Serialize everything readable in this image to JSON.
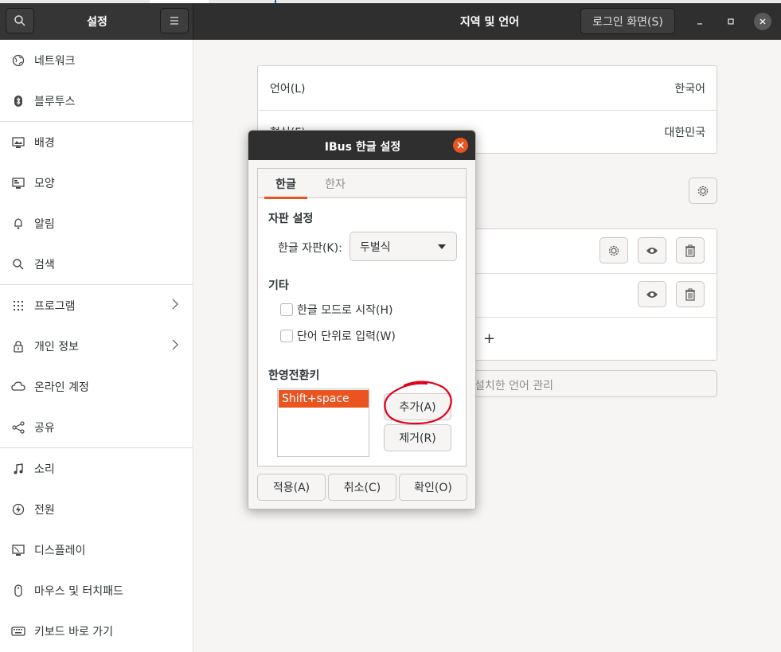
{
  "header": {
    "sidebar_title": "설정",
    "page_title": "지역 및 언어",
    "login_screen_button": "로그인 화면(S)"
  },
  "sidebar": {
    "items": [
      {
        "label": "네트워크",
        "icon": "network-icon"
      },
      {
        "label": "블루투스",
        "icon": "bluetooth-icon"
      },
      {
        "label": "배경",
        "icon": "background-icon"
      },
      {
        "label": "모양",
        "icon": "appearance-icon"
      },
      {
        "label": "알림",
        "icon": "bell-icon"
      },
      {
        "label": "검색",
        "icon": "search-icon"
      },
      {
        "label": "프로그램",
        "icon": "apps-grid-icon"
      },
      {
        "label": "개인 정보",
        "icon": "lock-icon"
      },
      {
        "label": "온라인 계정",
        "icon": "cloud-icon"
      },
      {
        "label": "공유",
        "icon": "share-icon"
      },
      {
        "label": "소리",
        "icon": "music-note-icon"
      },
      {
        "label": "전원",
        "icon": "power-icon"
      },
      {
        "label": "디스플레이",
        "icon": "display-icon"
      },
      {
        "label": "마우스 및 터치패드",
        "icon": "mouse-icon"
      },
      {
        "label": "키보드 바로 가기",
        "icon": "keyboard-icon"
      }
    ]
  },
  "region": {
    "language_label": "언어(L)",
    "language_value": "한국어",
    "formats_label": "형식(F)",
    "formats_value": "대한민국",
    "add_symbol": "+",
    "manage_languages": "설치한 언어 관리"
  },
  "dialog": {
    "title": "IBus 한글 설정",
    "tabs": [
      "한글",
      "한자"
    ],
    "keyboard_section": "자판 설정",
    "layout_label": "한글 자판(K):",
    "layout_value": "두벌식",
    "etc_section": "기타",
    "start_hangul_mode": "한글 모드로 시작(H)",
    "word_unit_input": "단어 단위로 입력(W)",
    "toggle_key_section": "한영전환키",
    "toggle_keys": [
      "Shift+space"
    ],
    "add_button": "추가(A)",
    "remove_button": "제거(R)",
    "apply_button": "적용(A)",
    "cancel_button": "취소(C)",
    "ok_button": "확인(O)"
  },
  "colors": {
    "accent": "#e95420",
    "headerbar": "#2f2f2f",
    "annotation": "#e0001b"
  }
}
